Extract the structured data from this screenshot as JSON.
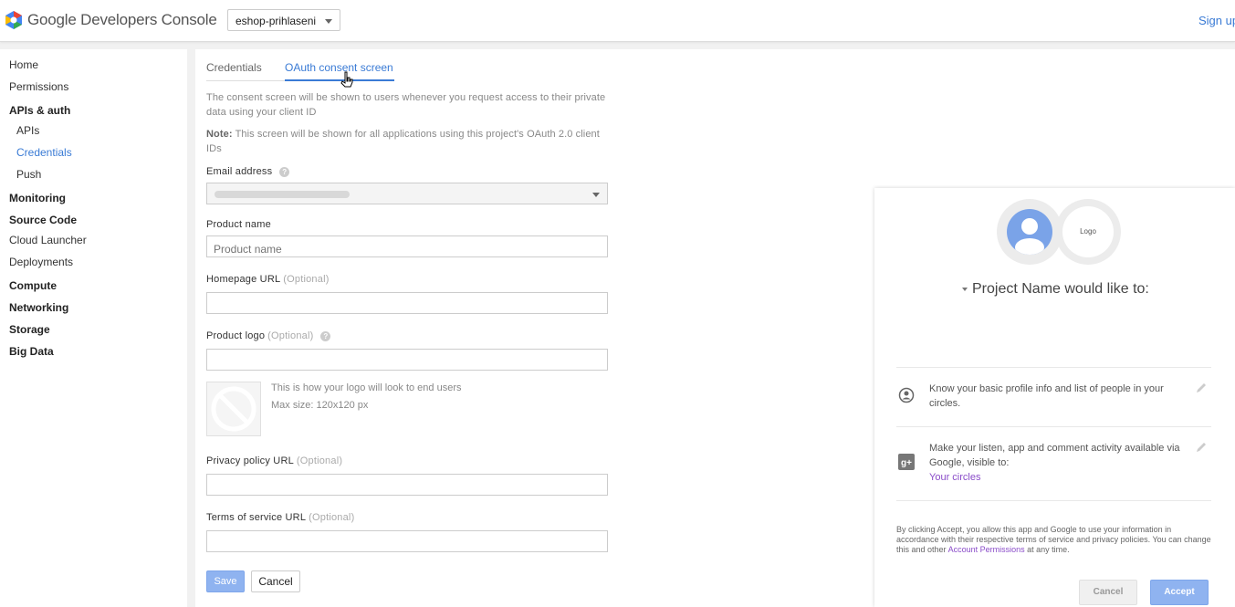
{
  "header": {
    "brand": "Google Developers Console",
    "project": "eshop-prihlaseni",
    "signup": "Sign up"
  },
  "sidebar": {
    "items": [
      {
        "label": "Home"
      },
      {
        "label": "Permissions"
      },
      {
        "label": "APIs & auth"
      },
      {
        "label": "APIs"
      },
      {
        "label": "Credentials"
      },
      {
        "label": "Push"
      },
      {
        "label": "Monitoring"
      },
      {
        "label": "Source Code"
      },
      {
        "label": "Cloud Launcher"
      },
      {
        "label": "Deployments"
      },
      {
        "label": "Compute"
      },
      {
        "label": "Networking"
      },
      {
        "label": "Storage"
      },
      {
        "label": "Big Data"
      }
    ],
    "active": "Credentials"
  },
  "tabs": {
    "credentials": "Credentials",
    "oauth": "OAuth consent screen"
  },
  "form": {
    "intro": "The consent screen will be shown to users whenever you request access to their private data using your client ID",
    "note_label": "Note:",
    "note_text": "This screen will be shown for all applications using this project's OAuth 2.0 client IDs",
    "email_label": "Email address",
    "product_name_label": "Product name",
    "product_name_placeholder": "Product name",
    "homepage_label": "Homepage URL",
    "product_logo_label": "Product logo",
    "optional": "(Optional)",
    "logo_note_1": "This is how your logo will look to end users",
    "logo_note_2": "Max size: 120x120 px",
    "privacy_label": "Privacy policy URL",
    "tos_label": "Terms of service URL",
    "save": "Save",
    "cancel": "Cancel"
  },
  "preview": {
    "logo_text": "Logo",
    "title": "Project Name would like to:",
    "perm1": "Know your basic profile info and list of people in your circles.",
    "perm2": "Make your listen, app and comment activity available via Google, visible to:",
    "perm2_link": "Your circles",
    "disclaimer_pre": "By clicking Accept, you allow this app and Google to use your information in accordance with their respective terms of service and privacy policies. You can change this and other",
    "disclaimer_link": "Account Permissions",
    "disclaimer_post": "at any time.",
    "cancel": "Cancel",
    "accept": "Accept"
  },
  "colors": {
    "accent": "#3a7bd5",
    "link_purple": "#8a4cc9",
    "button_blue": "#8fb3f0"
  }
}
